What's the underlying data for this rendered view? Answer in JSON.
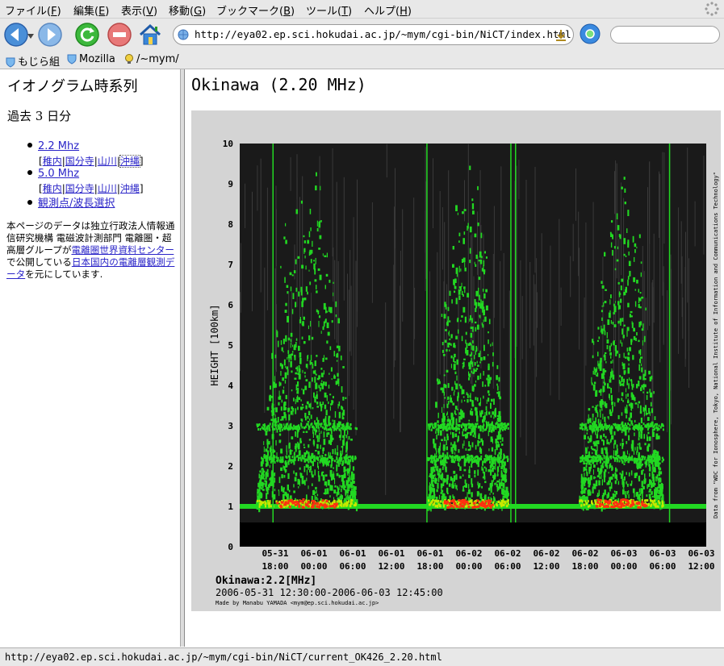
{
  "menu": [
    {
      "label": "ファイル(",
      "key": "F",
      "end": ")"
    },
    {
      "label": "編集(",
      "key": "E",
      "end": ")"
    },
    {
      "label": "表示(",
      "key": "V",
      "end": ")"
    },
    {
      "label": "移動(",
      "key": "G",
      "end": ")"
    },
    {
      "label": "ブックマーク(",
      "key": "B",
      "end": ")"
    },
    {
      "label": "ツール(",
      "key": "T",
      "end": ")"
    },
    {
      "label": "ヘルプ(",
      "key": "H",
      "end": ")"
    }
  ],
  "address": {
    "url": "http://eya02.ep.sci.hokudai.ac.jp/~mym/cgi-bin/NiCT/index.html"
  },
  "bookmarks": [
    "もじら組",
    "Mozilla",
    "/~mym/"
  ],
  "left": {
    "title": "イオノグラム時系列",
    "subtitle": "過去 3 日分",
    "freqs": [
      {
        "label": "2.2 Mhz",
        "stations": [
          "稚内",
          "国分寺",
          "山川",
          "沖縄"
        ]
      },
      {
        "label": "5.0 Mhz",
        "stations": [
          "稚内",
          "国分寺",
          "山川",
          "沖縄"
        ]
      }
    ],
    "select_link": "観測点/波長選択",
    "desc": {
      "t1": "本ページのデータは独立行政法人情報通信研究機構 電磁波計測部門 電離圏・超高層グループが",
      "l1": "電離圏世界資料センター",
      "t2": "で公開している",
      "l2": "日本国内の電離層観測データ",
      "t3": "を元にしています."
    }
  },
  "right": {
    "title": "Okinawa (2.20 MHz)"
  },
  "status": {
    "text": "http://eya02.ep.sci.hokudai.ac.jp/~mym/cgi-bin/NiCT/current_OK426_2.20.html"
  },
  "colors": {
    "chart_bg": "#d4d4d4",
    "plot_bg": "#1a1a1a",
    "echo_low": "#22d822",
    "echo_mid": "#c8e800",
    "echo_high": "#ff3010",
    "link": "#2a24c8"
  },
  "chart_data": {
    "type": "heatmap",
    "ylabel": "HEIGHT [100km]",
    "ylim": [
      0,
      10
    ],
    "yticks": [
      "0",
      "1",
      "2",
      "3",
      "4",
      "5",
      "6",
      "7",
      "8",
      "9",
      "10"
    ],
    "xticks": [
      {
        "date": "05-31",
        "time": "18:00"
      },
      {
        "date": "06-01",
        "time": "00:00"
      },
      {
        "date": "06-01",
        "time": "06:00"
      },
      {
        "date": "06-01",
        "time": "12:00"
      },
      {
        "date": "06-01",
        "time": "18:00"
      },
      {
        "date": "06-02",
        "time": "00:00"
      },
      {
        "date": "06-02",
        "time": "06:00"
      },
      {
        "date": "06-02",
        "time": "12:00"
      },
      {
        "date": "06-02",
        "time": "18:00"
      },
      {
        "date": "06-03",
        "time": "00:00"
      },
      {
        "date": "06-03",
        "time": "06:00"
      },
      {
        "date": "06-03",
        "time": "12:00"
      }
    ],
    "station_label": "Okinawa:2.2[MHz]",
    "period": "2006-05-31 12:30:00-2006-06-03 12:45:00",
    "credit": "Made by Manabu YAMADA <mym@ep.sci.hokudai.ac.jp>",
    "source": "Data from \"WDC for Ionosphere, Tokyo, National Institute of Information and Communications Technology\"",
    "nights": [
      {
        "start": "05-31 15:00",
        "end": "06-01 06:30"
      },
      {
        "start": "06-01 17:30",
        "end": "06-02 06:00"
      },
      {
        "start": "06-02 17:00",
        "end": "06-03 06:00"
      }
    ],
    "echo_floor_km": 100,
    "strong_layers_km": [
      110,
      220,
      300
    ]
  }
}
